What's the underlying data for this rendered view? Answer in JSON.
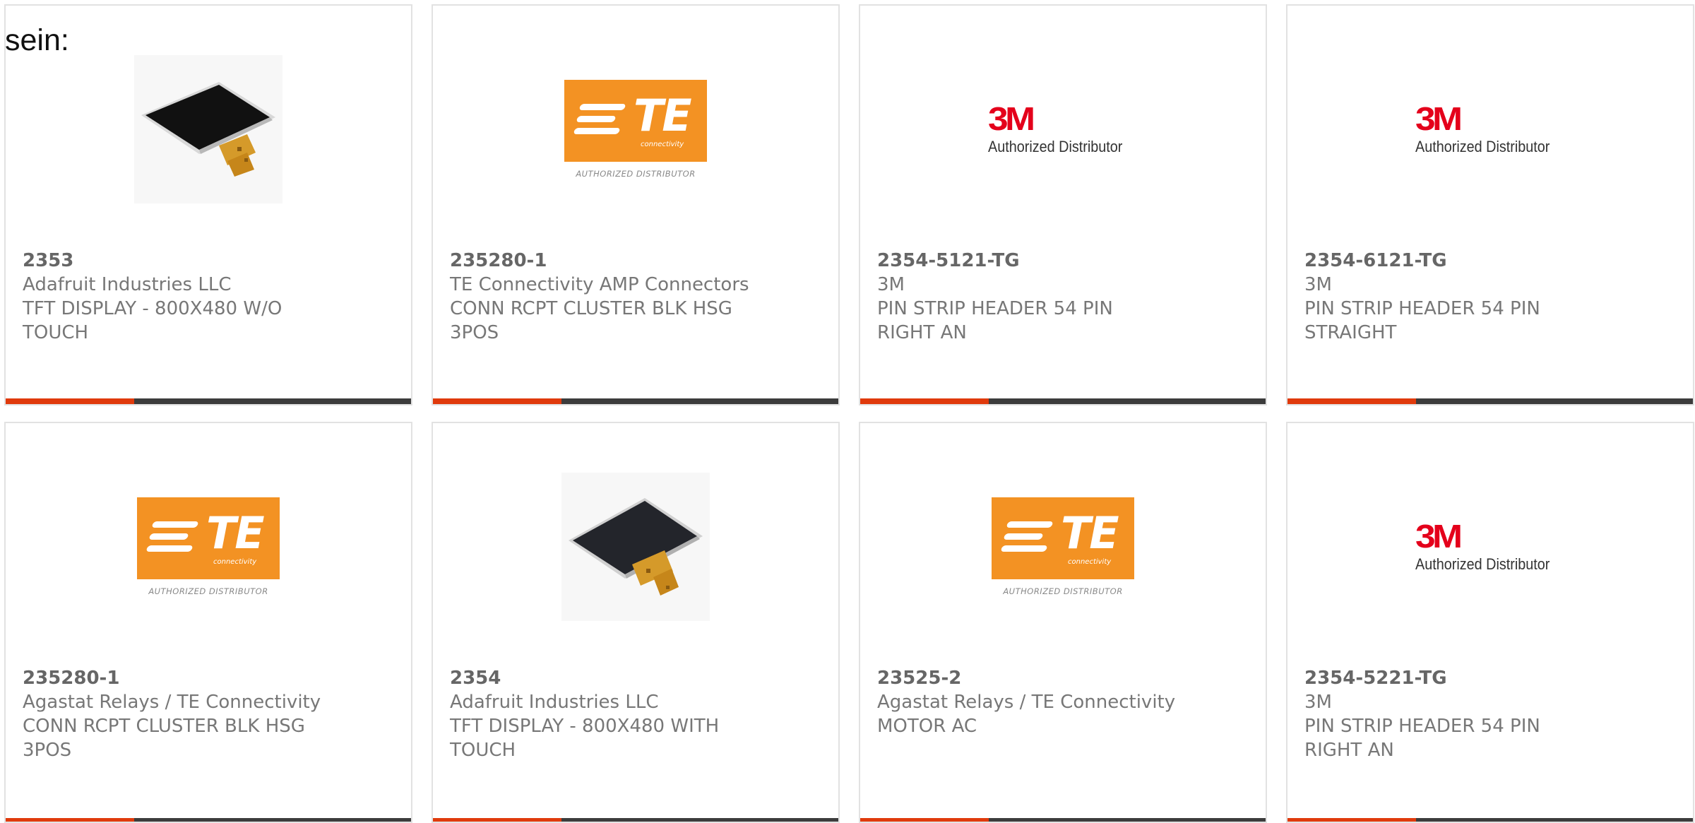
{
  "heading": "sein:",
  "products": [
    {
      "part": "2353",
      "maker": "Adafruit Industries LLC",
      "desc_line1": "TFT DISPLAY - 800X480 W/O",
      "desc_line2": "TOUCH",
      "image": "tft-display-image"
    },
    {
      "part": "235280-1",
      "maker": "TE Connectivity AMP Connectors",
      "desc_line1": "CONN RCPT CLUSTER BLK HSG",
      "desc_line2": "3POS",
      "image": "te-logo"
    },
    {
      "part": "2354-5121-TG",
      "maker": "3M",
      "desc_line1": "PIN STRIP HEADER 54 PIN",
      "desc_line2": "RIGHT AN",
      "image": "3m-logo"
    },
    {
      "part": "2354-6121-TG",
      "maker": "3M",
      "desc_line1": "PIN STRIP HEADER 54 PIN",
      "desc_line2": "STRAIGHT",
      "image": "3m-logo"
    },
    {
      "part": "235280-1",
      "maker": "Agastat Relays / TE Connectivity",
      "desc_line1": "CONN RCPT CLUSTER BLK HSG",
      "desc_line2": "3POS",
      "image": "te-logo"
    },
    {
      "part": "2354",
      "maker": "Adafruit Industries LLC",
      "desc_line1": "TFT DISPLAY - 800X480 WITH",
      "desc_line2": "TOUCH",
      "image": "tft-display-image"
    },
    {
      "part": "23525-2",
      "maker": "Agastat Relays / TE Connectivity",
      "desc_line1": "MOTOR AC",
      "desc_line2": "",
      "image": "te-logo"
    },
    {
      "part": "2354-5221-TG",
      "maker": "3M",
      "desc_line1": "PIN STRIP HEADER 54 PIN",
      "desc_line2": "RIGHT AN",
      "image": "3m-logo"
    }
  ],
  "logos": {
    "te_text": "TE",
    "te_sub": "connectivity",
    "te_caption": "AUTHORIZED DISTRIBUTOR",
    "mmm_text": "3M",
    "mmm_caption": "Authorized Distributor"
  },
  "colors": {
    "accent": "#e03a0c",
    "bar": "#3c3c3c",
    "te_orange": "#f39223",
    "mmm_red": "#e4001b"
  }
}
